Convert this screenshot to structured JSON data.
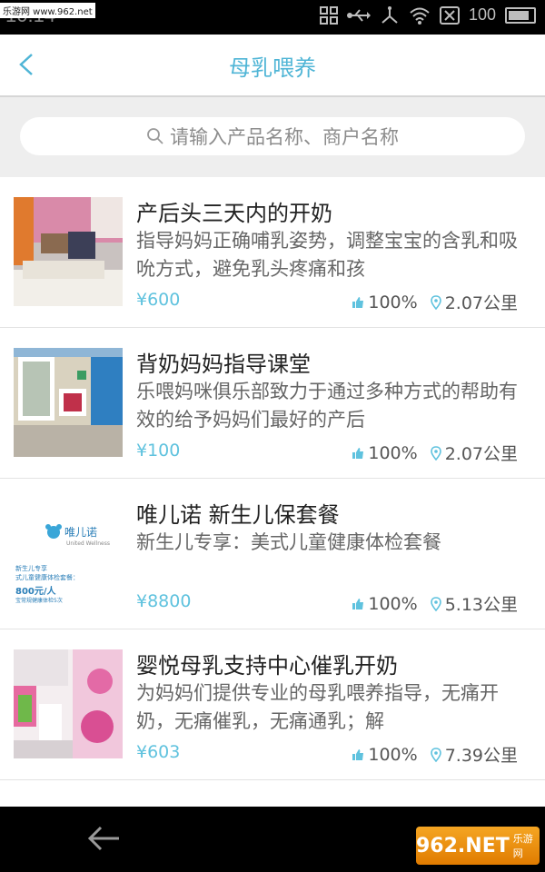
{
  "status_bar": {
    "time": "10:14",
    "watermark": "乐游网 www.962.net",
    "battery": "100"
  },
  "header": {
    "title": "母乳喂养"
  },
  "search": {
    "placeholder": "请输入产品名称、商户名称"
  },
  "items": [
    {
      "title": "产后头三天内的开奶",
      "desc": "指导妈妈正确哺乳姿势，调整宝宝的含乳和吸吮方式，避免乳头疼痛和孩",
      "price": "¥600",
      "rating": "100%",
      "distance": "2.07公里"
    },
    {
      "title": "背奶妈妈指导课堂",
      "desc": "乐喂妈咪俱乐部致力于通过多种方式的帮助有效的给予妈妈们最好的产后",
      "price": "¥100",
      "rating": "100%",
      "distance": "2.07公里"
    },
    {
      "title": "唯儿诺 新生儿保套餐",
      "desc": "新生儿专享：美式儿童健康体检套餐",
      "price": "¥8800",
      "rating": "100%",
      "distance": "5.13公里",
      "thumb_logo": "唯儿诺",
      "thumb_logo_sub": "United Wellness",
      "thumb_lines": [
        "新生儿专享",
        "式儿童健康体检套餐：",
        "800元/人",
        "宝常规健康体检5次"
      ]
    },
    {
      "title": "婴悦母乳支持中心催乳开奶",
      "desc": "为妈妈们提供专业的母乳喂养指导，无痛开奶，无痛催乳，无痛通乳；解",
      "price": "¥603",
      "rating": "100%",
      "distance": "7.39公里"
    }
  ],
  "bottom_bar": {
    "brand": "962.NET",
    "brand_sub": "乐游网"
  },
  "colors": {
    "accent": "#4fb5d6",
    "price": "#5fc2de"
  }
}
